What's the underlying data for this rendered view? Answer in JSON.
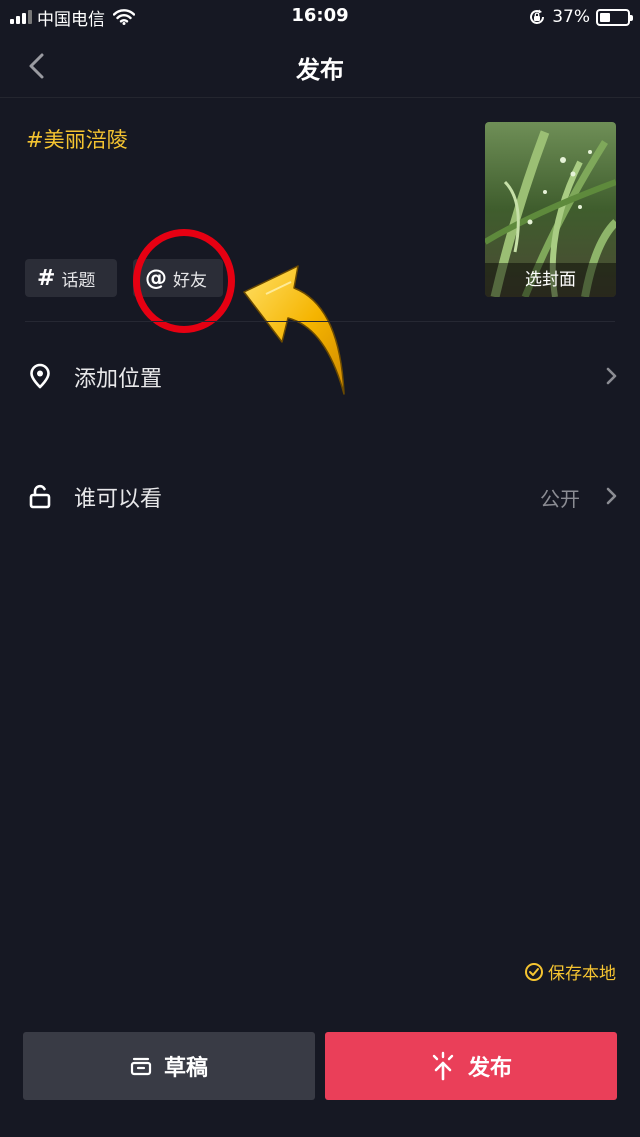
{
  "status_bar": {
    "carrier": "中国电信",
    "time": "16:09",
    "battery_percent": "37%",
    "battery_level": 0.37
  },
  "nav": {
    "title": "发布",
    "back_icon": "chevron-left-icon"
  },
  "post": {
    "description": "#美丽涪陵",
    "chips": {
      "topic": {
        "symbol": "#",
        "label": "话题"
      },
      "friend": {
        "symbol": "@",
        "label": "好友"
      }
    },
    "cover_label": "选封面"
  },
  "rows": {
    "location": {
      "label": "添加位置",
      "icon": "location-pin-icon"
    },
    "visibility": {
      "label": "谁可以看",
      "value": "公开",
      "icon": "unlock-icon"
    }
  },
  "save_local": {
    "label": "保存本地",
    "checked": true
  },
  "buttons": {
    "draft": "草稿",
    "publish": "发布"
  },
  "colors": {
    "background": "#161823",
    "accent_yellow": "#f5c431",
    "publish_red": "#ea3f59",
    "draft_gray": "#393b45",
    "annotation_red": "#e60012"
  }
}
